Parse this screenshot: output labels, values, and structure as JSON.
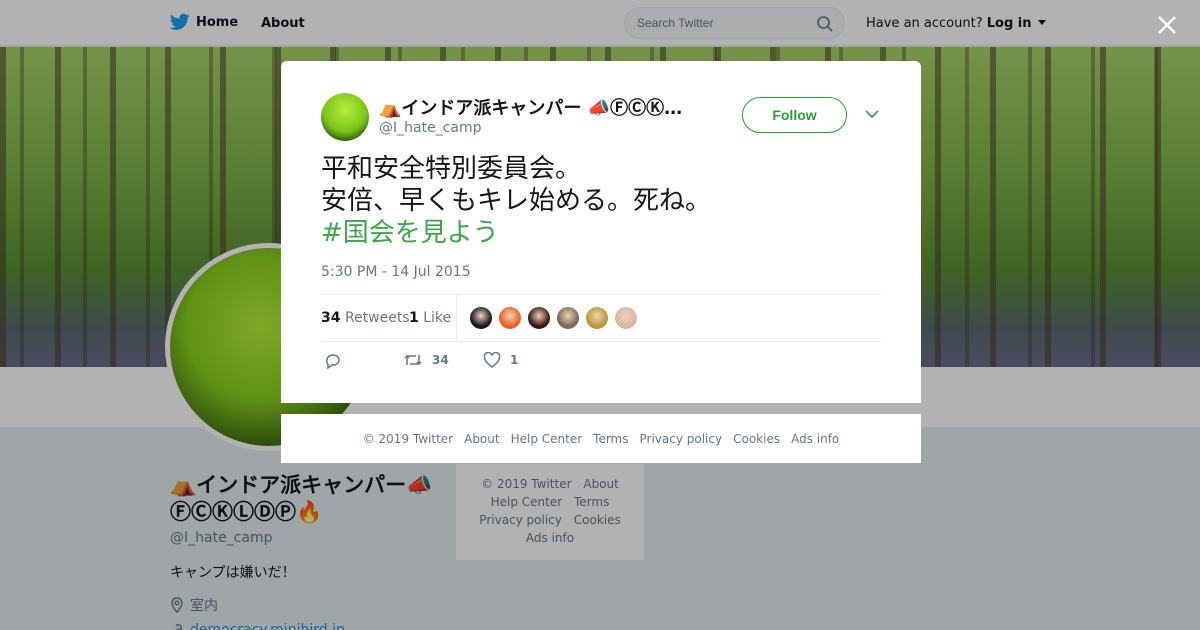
{
  "nav": {
    "home_label": "Home",
    "about_label": "About",
    "search_placeholder": "Search Twitter",
    "account_prompt": "Have an account?",
    "login_label": "Log in"
  },
  "profile": {
    "name": "⛺インドア派キャンパー📣ⒻⒸⓀⓁⒹⓅ🔥",
    "handle": "@I_hate_camp",
    "bio": "キャンプは嫌いだ！",
    "location": "室内",
    "url": "democracy.minibird.jp"
  },
  "side_footer": {
    "items": [
      "© 2019 Twitter",
      "About",
      "Help Center",
      "Terms",
      "Privacy policy",
      "Cookies",
      "Ads info"
    ]
  },
  "tweet": {
    "author_name": "⛺インドア派キャンパー 📣ⒻⒸⓀ…",
    "author_handle": "@I_hate_camp",
    "follow_label": "Follow",
    "line1": "平和安全特別委員会。",
    "line2": "安倍、早くもキレ始める。死ね。",
    "hashtag": "#国会を見よう",
    "timestamp": "5:30 PM - 14 Jul 2015",
    "retweet_count": "34",
    "retweet_label": "Retweets",
    "like_count": "1",
    "like_label": "Like",
    "action_retweet_count": "34",
    "action_like_count": "1",
    "face_colors": [
      "#1a1a22",
      "#e8632a",
      "#3a1a12",
      "#7a6a5a",
      "#b89a3a",
      "#d9b8a0"
    ]
  },
  "modal_footer": {
    "items": [
      "© 2019 Twitter",
      "About",
      "Help Center",
      "Terms",
      "Privacy policy",
      "Cookies",
      "Ads info"
    ]
  },
  "colors": {
    "accent": "#3ea34a",
    "twitter_blue": "#1da1f2"
  }
}
